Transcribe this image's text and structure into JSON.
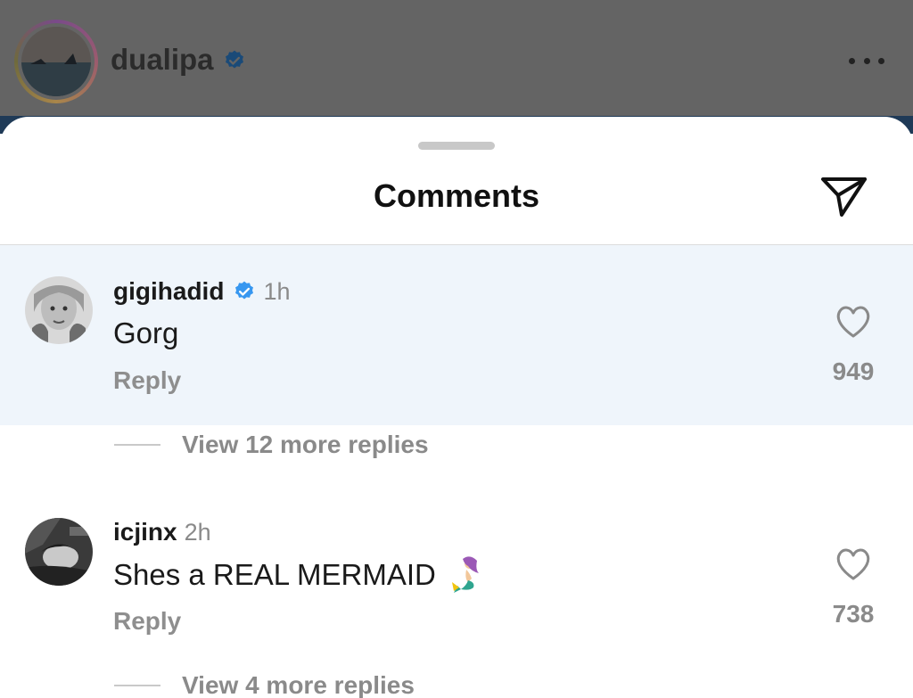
{
  "post": {
    "username": "dualipa",
    "verified": true,
    "more_icon": "more-horizontal-icon"
  },
  "sheet": {
    "title": "Comments",
    "share_icon": "paper-plane-icon"
  },
  "comments": [
    {
      "username": "gigihadid",
      "verified": true,
      "time": "1h",
      "text": "Gorg",
      "reply_label": "Reply",
      "likes": "949",
      "view_replies": "View 12 more replies",
      "highlighted": true
    },
    {
      "username": "icjinx",
      "verified": false,
      "time": "2h",
      "text": "Shes a REAL MERMAID",
      "emoji": "mermaid-emoji",
      "reply_label": "Reply",
      "likes": "738",
      "view_replies": "View 4 more replies",
      "highlighted": false
    }
  ],
  "colors": {
    "verified_blue": "#3797f0",
    "highlight_bg": "#eff5fb",
    "muted_text": "#8a8a8a"
  }
}
